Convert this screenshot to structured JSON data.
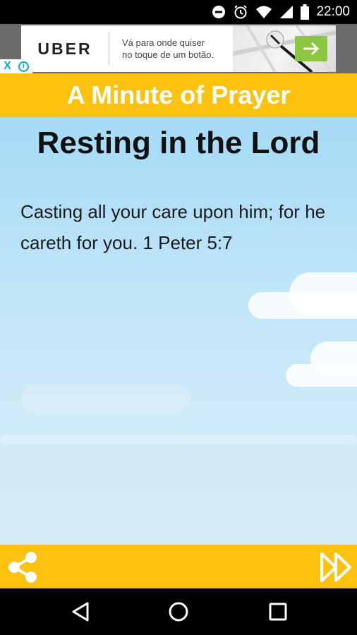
{
  "status_bar": {
    "time": "22:00",
    "icons": [
      "do-not-disturb-icon",
      "alarm-icon",
      "wifi-icon",
      "signal-icon",
      "battery-icon"
    ]
  },
  "ad": {
    "brand": "UBER",
    "text_line1": "Vá para onde quiser",
    "text_line2": "no toque de um botão.",
    "close_glyph": "X",
    "info_glyph": "i",
    "accent_color": "#8cc63f"
  },
  "header": {
    "title": "A Minute of Prayer",
    "color": "#fcc20f"
  },
  "verse": {
    "title": "Resting in the Lord",
    "text": "Casting all your care upon him; for he careth for you. 1 Peter 5:7"
  },
  "actions": {
    "share_icon": "share-icon",
    "next_icon": "fast-forward-icon"
  },
  "nav": {
    "icons": [
      "back-icon",
      "home-icon",
      "recents-icon"
    ]
  }
}
